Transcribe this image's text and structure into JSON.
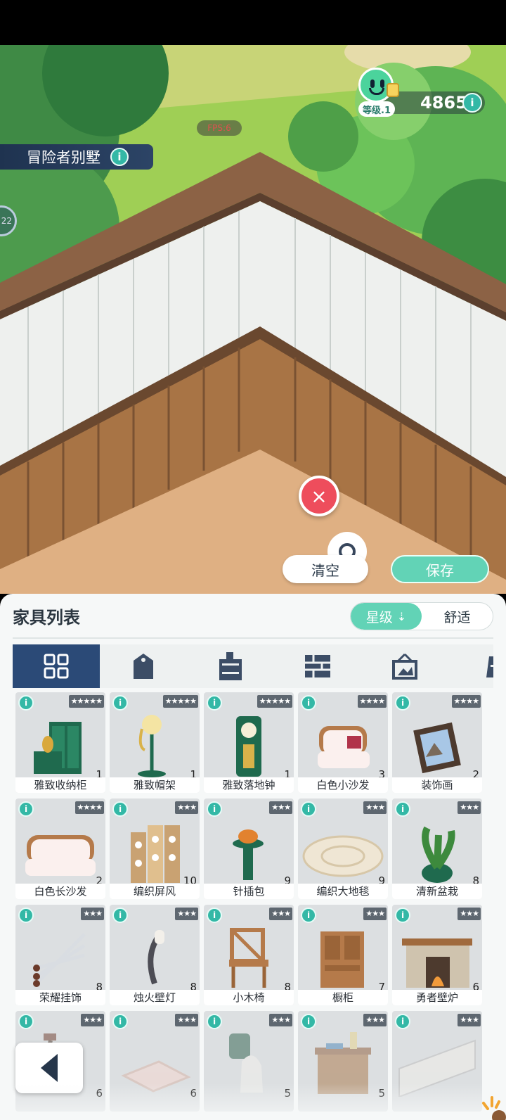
{
  "villa": {
    "name": "冒险者别墅",
    "info_icon": "i"
  },
  "player": {
    "level_label": "等级.1",
    "currency": "4865",
    "info_icon": "i"
  },
  "fps": "FPS:6",
  "side_bubble": "22",
  "actions": {
    "clear": "清空",
    "save": "保存",
    "close_icon": "×"
  },
  "panel": {
    "title": "家具列表",
    "sort": {
      "star": "星级",
      "comfort": "舒适",
      "active": "star"
    },
    "categories": [
      "all-grid-icon",
      "theme-icon",
      "cabinet-icon",
      "wall-icon",
      "frame-icon",
      "door-icon"
    ]
  },
  "items": [
    {
      "name": "雅致收纳柜",
      "count": "1",
      "stars": "★★★★★",
      "art": "cabinet"
    },
    {
      "name": "雅致帽架",
      "count": "1",
      "stars": "★★★★★",
      "art": "hatstand"
    },
    {
      "name": "雅致落地钟",
      "count": "1",
      "stars": "★★★★★",
      "art": "clock"
    },
    {
      "name": "白色小沙发",
      "count": "3",
      "stars": "★★★★",
      "art": "armchair"
    },
    {
      "name": "装饰画",
      "count": "2",
      "stars": "★★★★",
      "art": "painting"
    },
    {
      "name": "白色长沙发",
      "count": "2",
      "stars": "★★★★",
      "art": "sofa"
    },
    {
      "name": "编织屏风",
      "count": "10",
      "stars": "★★★",
      "art": "screen"
    },
    {
      "name": "针插包",
      "count": "9",
      "stars": "★★★",
      "art": "pincushion"
    },
    {
      "name": "编织大地毯",
      "count": "9",
      "stars": "★★★",
      "art": "rug"
    },
    {
      "name": "清新盆栽",
      "count": "8",
      "stars": "★★★",
      "art": "plant"
    },
    {
      "name": "荣耀挂饰",
      "count": "8",
      "stars": "★★★",
      "art": "swords"
    },
    {
      "name": "烛火壁灯",
      "count": "8",
      "stars": "★★★",
      "art": "walllamp"
    },
    {
      "name": "小木椅",
      "count": "8",
      "stars": "★★★",
      "art": "chair"
    },
    {
      "name": "橱柜",
      "count": "7",
      "stars": "★★★",
      "art": "cupboard"
    },
    {
      "name": "勇者壁炉",
      "count": "6",
      "stars": "★★★",
      "art": "fireplace"
    },
    {
      "name": "",
      "count": "6",
      "stars": "★★★",
      "art": "lever"
    },
    {
      "name": "",
      "count": "6",
      "stars": "★★★",
      "art": "mat"
    },
    {
      "name": "",
      "count": "5",
      "stars": "★★★",
      "art": "ghost"
    },
    {
      "name": "",
      "count": "5",
      "stars": "★★★",
      "art": "shelf"
    },
    {
      "name": "",
      "count": "",
      "stars": "★★★",
      "art": "fence"
    }
  ]
}
